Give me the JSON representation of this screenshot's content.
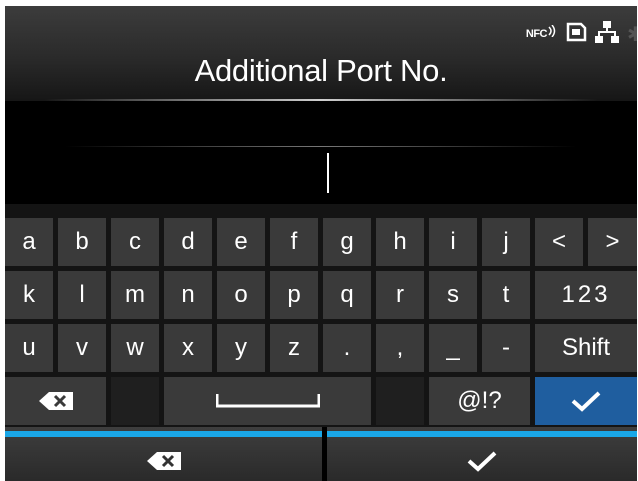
{
  "status": {
    "nfc_label": "NFC"
  },
  "title": "Additional Port No.",
  "input": {
    "value": ""
  },
  "keyboard": {
    "rows": [
      [
        "a",
        "b",
        "c",
        "d",
        "e",
        "f",
        "g",
        "h",
        "i",
        "j",
        "<",
        ">"
      ],
      [
        "k",
        "l",
        "m",
        "n",
        "o",
        "p",
        "q",
        "r",
        "s",
        "t",
        "123"
      ],
      [
        "u",
        "v",
        "w",
        "x",
        "y",
        "z",
        ".",
        ",",
        "_",
        "-",
        "Shift"
      ],
      [
        "",
        "",
        "",
        "@!?",
        ""
      ]
    ]
  },
  "colors": {
    "accent": "#1aa7e8",
    "enter_key": "#1f5e9f",
    "key": "#3a3a3a"
  },
  "icons": {
    "status": [
      "nfc-icon",
      "sd-card-icon",
      "network-icon",
      "bluetooth-icon"
    ],
    "keyboard": [
      "backspace-icon",
      "space-icon",
      "checkmark-icon"
    ],
    "bottom": [
      "backspace-icon",
      "checkmark-icon"
    ]
  }
}
